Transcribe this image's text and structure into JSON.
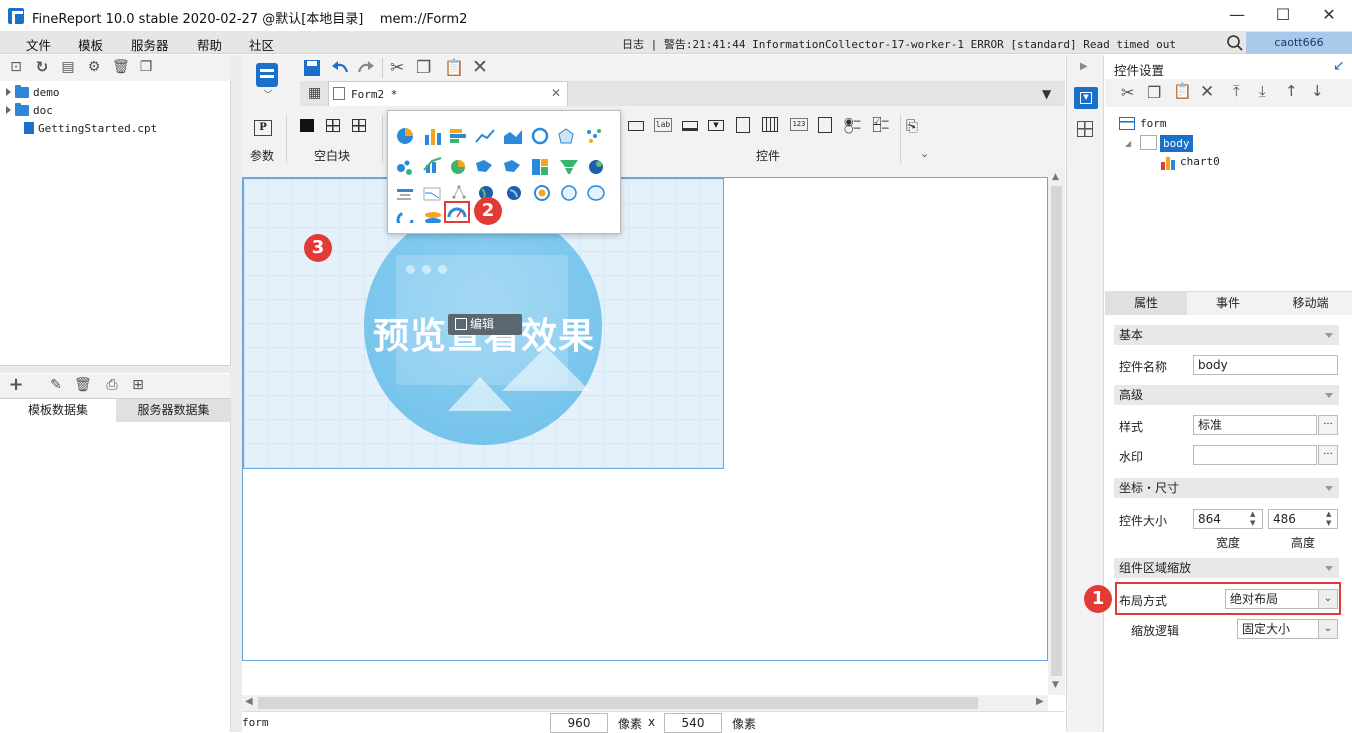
{
  "window": {
    "title": "FineReport 10.0 stable 2020-02-27 @默认[本地目录]    mem://Form2",
    "minimize": "—",
    "maximize": "☐",
    "close": "✕"
  },
  "menu": {
    "items": [
      "文件",
      "模板",
      "服务器",
      "帮助",
      "社区"
    ],
    "log_text": "日志 | 警告:21:41:44 InformationCollector-17-worker-1 ERROR [standard] Read timed out",
    "user": "caott666"
  },
  "left": {
    "tree": [
      "demo",
      "doc",
      "GettingStarted.cpt"
    ],
    "tabs": [
      "模板数据集",
      "服务器数据集"
    ]
  },
  "editor": {
    "tab_label": "Form2 *",
    "groups": {
      "params": "参数",
      "blank": "空白块",
      "widgets": "控件"
    },
    "param_icon": "P",
    "widget_lab": "lab",
    "widget_123": "123",
    "chart_popup": {
      "badge": "2"
    },
    "canvas_badge": "3",
    "preview_text": "预览查看效果",
    "edit_label": "编辑",
    "status_left": "form",
    "width_value": "960",
    "height_value": "540",
    "unit_px": "像素",
    "times": "x"
  },
  "right": {
    "panel_title": "控件设置",
    "tree": {
      "root": "form",
      "body": "body",
      "chart": "chart0"
    },
    "tabs": [
      "属性",
      "事件",
      "移动端"
    ],
    "sections": {
      "basic": "基本",
      "advanced": "高级",
      "coords": "坐标・尺寸",
      "scale": "组件区域缩放"
    },
    "props": {
      "name_label": "控件名称",
      "name_value": "body",
      "style_label": "样式",
      "style_value": "标准",
      "watermark_label": "水印",
      "watermark_value": "",
      "size_label": "控件大小",
      "width": "864",
      "height": "486",
      "width_label": "宽度",
      "height_label": "高度",
      "layout_label": "布局方式",
      "layout_value": "绝对布局",
      "scale_label": "缩放逻辑",
      "scale_value": "固定大小",
      "ellipsis": "···"
    },
    "badge": "1"
  },
  "colors": {
    "accent": "#1b70c9",
    "highlight": "#e23a36",
    "selection": "#a9c8ea"
  }
}
